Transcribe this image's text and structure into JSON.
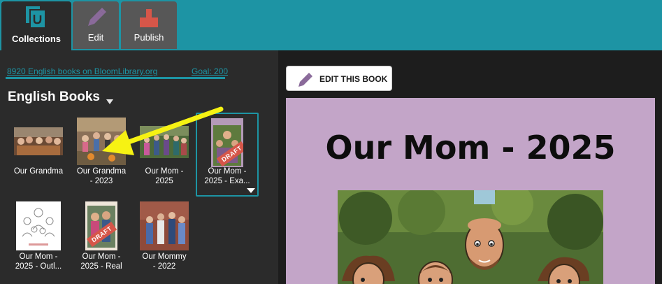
{
  "tabs": {
    "collections": "Collections",
    "edit": "Edit",
    "publish": "Publish"
  },
  "collection": {
    "stats_link": "8920 English books on BloomLibrary.org",
    "goal": "Goal: 200",
    "title": "English Books"
  },
  "books": [
    {
      "title": "Our Grandma",
      "draft": false
    },
    {
      "title": "Our Grandma\n- 2023",
      "draft": false
    },
    {
      "title": "Our Mom -\n2025",
      "draft": false
    },
    {
      "title": "Our Mom -\n2025 - Exa...",
      "draft": true,
      "selected": true
    },
    {
      "title": "Our Mom -\n2025 - Outl...",
      "draft": false
    },
    {
      "title": "Our Mom -\n2025 - Real",
      "draft": true
    },
    {
      "title": "Our Mommy\n- 2022",
      "draft": false
    }
  ],
  "draft_label": "DRAFT",
  "preview": {
    "edit_button": "EDIT THIS BOOK",
    "book_title": "Our Mom - 2025"
  },
  "colors": {
    "accent": "#1d94a4",
    "panel": "#2b2b2b",
    "preview_bg": "#c3a5c8",
    "arrow": "#f6f213",
    "draft": "#d65649"
  }
}
